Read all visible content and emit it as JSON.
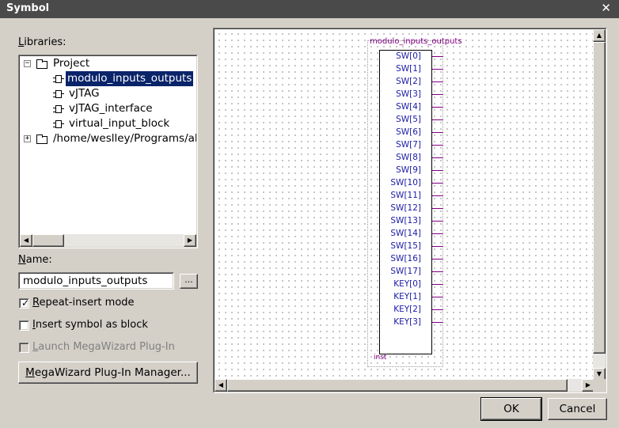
{
  "window": {
    "title": "Symbol",
    "close_glyph": "✕"
  },
  "libraries": {
    "label_prefix": "",
    "label_mnemonic": "L",
    "label_rest": "ibraries:",
    "tree": [
      {
        "label": "Project",
        "expander": "−",
        "icon": "folder-open-icon"
      },
      {
        "label": "modulo_inputs_outputs",
        "icon": "symbol-chip-icon",
        "selected": true
      },
      {
        "label": "vJTAG",
        "icon": "symbol-chip-icon"
      },
      {
        "label": "vJTAG_interface",
        "icon": "symbol-chip-icon"
      },
      {
        "label": "virtual_input_block",
        "icon": "symbol-chip-icon"
      },
      {
        "label": "/home/weslley/Programs/al",
        "expander": "+",
        "icon": "folder-icon"
      }
    ]
  },
  "name_field": {
    "label_mnemonic": "N",
    "label_rest": "ame:",
    "value": "modulo_inputs_outputs",
    "browse_label": "..."
  },
  "options": {
    "repeat_insert": {
      "mnemonic": "R",
      "rest": "epeat-insert mode",
      "checked": true
    },
    "insert_as_block": {
      "mnemonic": "I",
      "rest": "nsert symbol as block",
      "checked": false
    },
    "launch_megawizard": {
      "mnemonic": "L",
      "rest": "aunch MegaWizard Plug-In",
      "checked": false,
      "disabled": true
    }
  },
  "megawizard_button": {
    "mnemonic": "M",
    "rest": "egaWizard Plug-In Manager..."
  },
  "symbol": {
    "name": "modulo_inputs_outputs",
    "instance": "inst",
    "pins": [
      "SW[0]",
      "SW[1]",
      "SW[2]",
      "SW[3]",
      "SW[4]",
      "SW[5]",
      "SW[6]",
      "SW[7]",
      "SW[8]",
      "SW[9]",
      "SW[10]",
      "SW[11]",
      "SW[12]",
      "SW[13]",
      "SW[14]",
      "SW[15]",
      "SW[16]",
      "SW[17]",
      "KEY[0]",
      "KEY[1]",
      "KEY[2]",
      "KEY[3]"
    ]
  },
  "buttons": {
    "ok": "OK",
    "cancel": "Cancel"
  },
  "colors": {
    "selection": "#0a246a",
    "pin_text": "#1a1aa6",
    "pin_line": "#800080",
    "symbol_title": "#800080"
  }
}
